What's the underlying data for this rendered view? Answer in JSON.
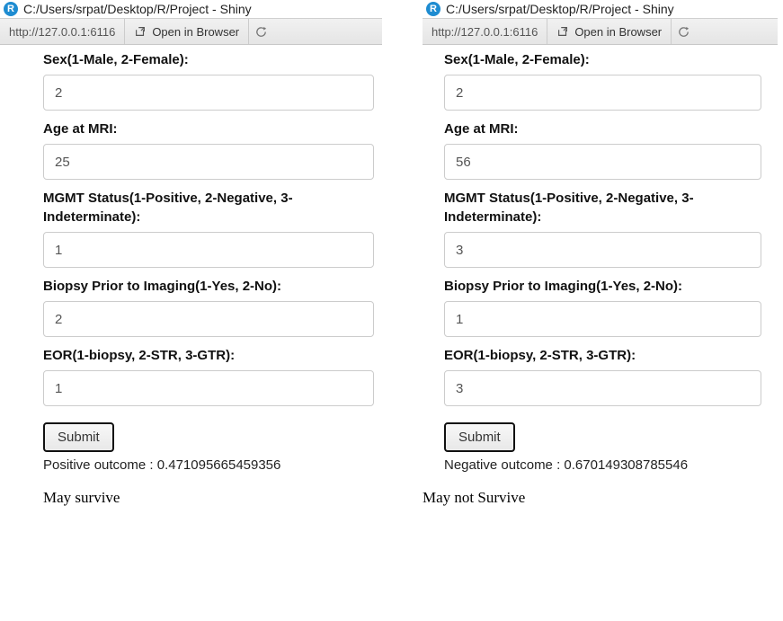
{
  "window": {
    "icon_letter": "R",
    "title": "C:/Users/srpat/Desktop/R/Project - Shiny"
  },
  "toolbar": {
    "address": "http://127.0.0.1:6116",
    "open_browser_label": "Open in Browser"
  },
  "form": {
    "sex_label": "Sex(1-Male, 2-Female):",
    "age_label": "Age at MRI:",
    "mgmt_label": "MGMT Status(1-Positive, 2-Negative, 3-Indeterminate):",
    "biopsy_label": "Biopsy Prior to Imaging(1-Yes, 2-No):",
    "eor_label": "EOR(1-biopsy, 2-STR, 3-GTR):",
    "submit_label": "Submit"
  },
  "left": {
    "values": {
      "sex": "2",
      "age": "25",
      "mgmt": "1",
      "biopsy": "2",
      "eor": "1"
    },
    "outcome": "Positive outcome : 0.471095665459356",
    "caption": "May survive"
  },
  "right": {
    "values": {
      "sex": "2",
      "age": "56",
      "mgmt": "3",
      "biopsy": "1",
      "eor": "3"
    },
    "outcome": "Negative outcome : 0.670149308785546",
    "caption": "May not Survive"
  }
}
